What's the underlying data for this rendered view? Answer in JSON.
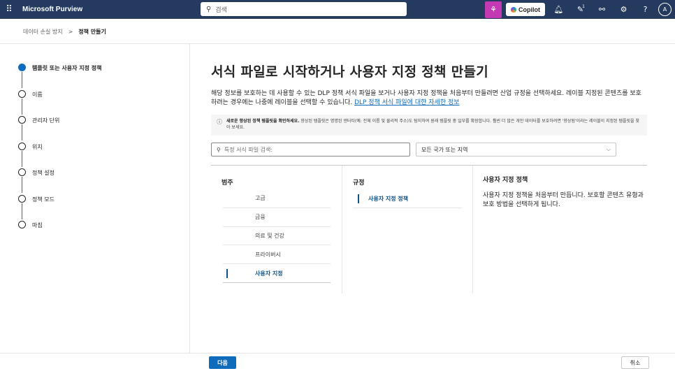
{
  "topbar": {
    "waffle_icon": "waffle-icon",
    "app_title": "Microsoft Purview",
    "search_placeholder": "검색",
    "copilot_label": "Copilot",
    "avatar_initial": "A",
    "notification_count": "1",
    "colors": {
      "bar": "#243a5e",
      "pink_button": "#c239b3"
    }
  },
  "breadcrumb": {
    "parent": "데이터 손실 방지",
    "separator": ">",
    "current": "정책 만들기"
  },
  "wizard": {
    "steps": [
      {
        "label": "템플릿 또는 사용자 지정 정책",
        "active": true
      },
      {
        "label": "이름"
      },
      {
        "label": "관리자 단위"
      },
      {
        "label": "위치"
      },
      {
        "label": "정책 설정"
      },
      {
        "label": "정책 모드"
      },
      {
        "label": "마침"
      }
    ]
  },
  "main": {
    "title": "서식 파일로 시작하거나 사용자 지정 정책 만들기",
    "description": "해당 정보를 보호하는 데 사용할 수 있는 DLP 정책 서식 파일을 보거나 사용자 지정 정책을 처음부터 만들려면 산업 규정을 선택하세요. 레이블 지정된 콘텐츠를 보호하려는 경우에는 나중에 레이블을 선택할 수 있습니다.",
    "learn_more_link": "DLP 정책 서식 파일에 대한 자세한 정보",
    "notice_bold": "새로운 향상된 정책 템플릿을 확인하세요.",
    "notice_text": "향상된 템플릿은 명명된 엔터티(예: 전체 이름 및 물리적 주소)도 탐지하여 원래 템플릿 중 일부를 확장합니다. 훨씬 더 많은 개인 데이터를 보호하려면 '향상됨'이라는 레이블이 지정된 템플릿을 찾아 보세요.",
    "template_search_placeholder": "특정 서식 파일 검색:",
    "country_select": "모든 국가 또는 지역"
  },
  "table": {
    "categories_header": "범주",
    "categories": [
      "고급",
      "금융",
      "의료 및 건강",
      "프라이버시",
      "사용자 지정"
    ],
    "selected_category": "사용자 지정",
    "rules_header": "규정",
    "rules": [
      "사용자 지정 정책"
    ],
    "detail_title": "사용자 지정 정책",
    "detail_text": "사용자 지정 정책을 처음부터 만듭니다. 보호할 콘텐츠 유형과 보호 방법을 선택하게 됩니다."
  },
  "footer": {
    "next_label": "다음",
    "cancel_label": "취소"
  }
}
